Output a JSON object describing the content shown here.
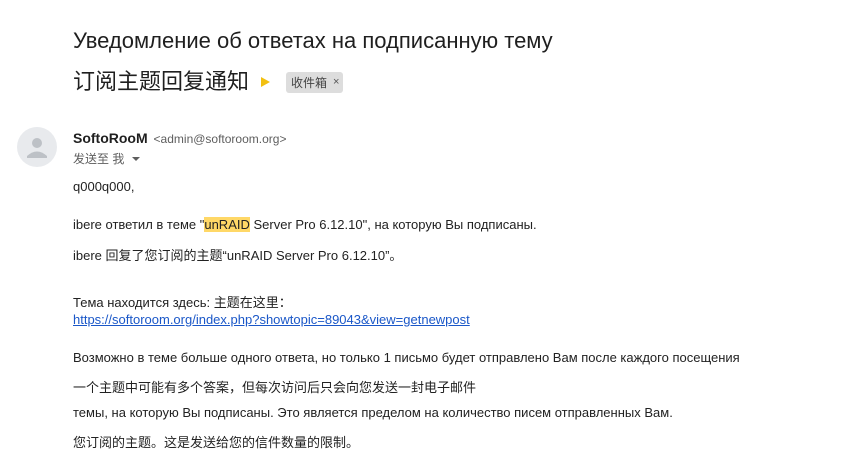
{
  "email": {
    "subject_ru": "Уведомление об ответах на подписанную тему",
    "subject_zh": "订阅主题回复通知",
    "label": "收件箱",
    "label_remove": "×",
    "sender_name": "SoftoRooM",
    "sender_email": "<admin@softoroom.org>",
    "to_line": "发送至 我",
    "body": {
      "greeting": "q000q000,",
      "reply_ru_before": "ibere ответил в теме \"",
      "reply_ru_highlight": "unRAID",
      "reply_ru_after": " Server Pro 6.12.10\", на которую Вы подписаны.",
      "reply_zh": "ibere 回复了您订阅的主题“unRAID Server Pro 6.12.10”。",
      "location_label": "Тема находится здесь:  主题在这里：",
      "location_link": "https://softoroom.org/index.php?showtopic=89043&view=getnewpost",
      "notice_ru_1": "Возможно в теме больше одного ответа, но только 1 письмо будет отправлено Вам после каждого посещения",
      "notice_zh_1": "一个主题中可能有多个答案，但每次访问后只会向您发送一封电子邮件",
      "notice_ru_2": "темы, на которую Вы подписаны. Это является пределом на количество писем отправленных Вам.",
      "notice_zh_2": "您订阅的主题。这是发送给您的信件数量的限制。"
    }
  },
  "colors": {
    "highlight": "#ffd867",
    "importance_marker": "#f2c011",
    "link": "#1a57c8",
    "label_chip_bg": "#dddddd"
  },
  "icons": {
    "importance": "importance-marker-icon",
    "avatar": "default-avatar-icon",
    "details": "chevron-down-icon"
  }
}
